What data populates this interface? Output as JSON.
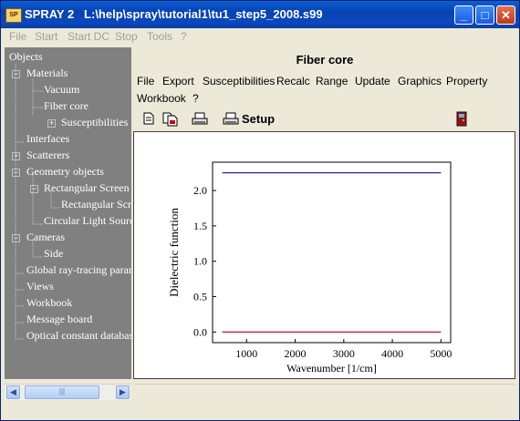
{
  "window": {
    "app_name": "SPRAY 2",
    "file_path": "L:\\help\\spray\\tutorial1\\tu1_step5_2008.s99",
    "icon_label": "SP",
    "minimize_label": "_",
    "maximize_label": "□",
    "close_label": "✕"
  },
  "menubar": {
    "items": [
      "File",
      "Start",
      "Start DC",
      "Stop",
      "Tools",
      "?"
    ]
  },
  "tree": {
    "root": "Objects",
    "nodes": [
      {
        "label": "Materials",
        "expander": "−"
      },
      {
        "label": "Vacuum"
      },
      {
        "label": "Fiber core"
      },
      {
        "label": "Susceptibilities",
        "expander": "+"
      },
      {
        "label": "Interfaces"
      },
      {
        "label": "Scatterers",
        "expander": "+"
      },
      {
        "label": "Geometry objects",
        "expander": "−"
      },
      {
        "label": "Rectangular Screen",
        "expander": "−"
      },
      {
        "label": "Rectangular Screen"
      },
      {
        "label": "Circular Light Source"
      },
      {
        "label": "Cameras",
        "expander": "−"
      },
      {
        "label": "Side"
      },
      {
        "label": "Global ray-tracing parameters"
      },
      {
        "label": "Views"
      },
      {
        "label": "Workbook"
      },
      {
        "label": "Message board"
      },
      {
        "label": "Optical constant database"
      }
    ]
  },
  "scrollbar": {
    "left_arrow": "◀",
    "right_arrow": "▶",
    "thumb_grip": "|||"
  },
  "panel": {
    "title": "Fiber core",
    "menu": [
      "File",
      "Export",
      "Susceptibilities",
      "Recalc",
      "Range",
      "Update",
      "Graphics",
      "Property",
      "Workbook",
      "?"
    ],
    "setup_label": "Setup"
  },
  "chart_data": {
    "type": "line",
    "xlabel": "Wavenumber [1/cm]",
    "ylabel": "Dielectric function",
    "xlim": [
      300,
      5200
    ],
    "ylim": [
      -0.15,
      2.4
    ],
    "x_ticks": [
      1000,
      2000,
      3000,
      4000,
      5000
    ],
    "y_ticks": [
      0.0,
      0.5,
      1.0,
      1.5,
      2.0
    ],
    "x_tick_labels": [
      "1000",
      "2000",
      "3000",
      "4000",
      "5000"
    ],
    "y_tick_labels": [
      "0.0",
      "0.5",
      "1.0",
      "1.5",
      "2.0"
    ],
    "series": [
      {
        "color": "#1f2a8c",
        "x": [
          500,
          5000
        ],
        "values": [
          2.25,
          2.25
        ]
      },
      {
        "color": "#c0102a",
        "x": [
          500,
          5000
        ],
        "values": [
          0.0,
          0.0
        ]
      }
    ],
    "grid": false
  }
}
